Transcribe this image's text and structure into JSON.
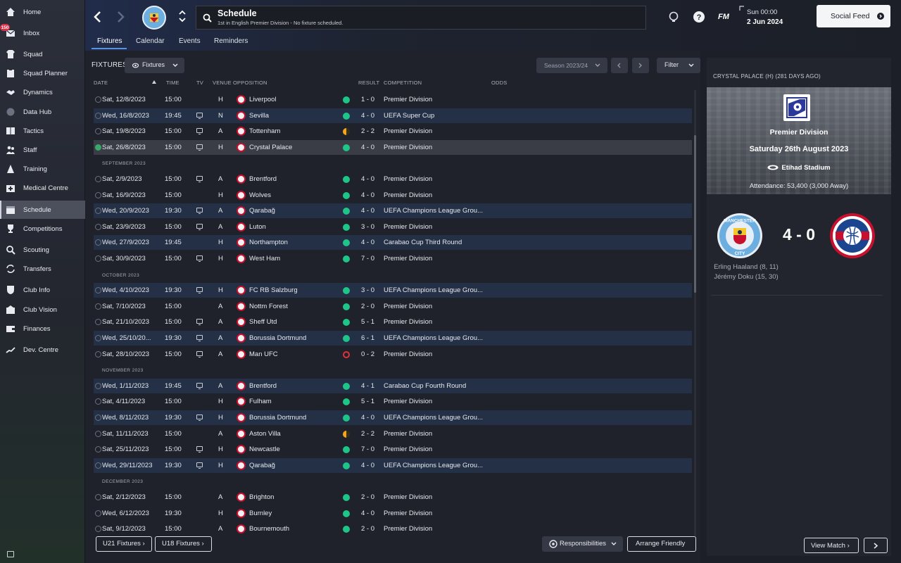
{
  "sidebar": {
    "items": [
      {
        "label": "Home",
        "icon": "home-icon"
      },
      {
        "label": "Inbox",
        "icon": "inbox-icon",
        "badge": "150"
      },
      {
        "label": "Squad",
        "icon": "shirt-icon"
      },
      {
        "label": "Squad Planner",
        "icon": "clipboard-icon"
      },
      {
        "label": "Dynamics",
        "icon": "handshake-icon"
      },
      {
        "label": "Data Hub",
        "icon": "data-hub-icon"
      },
      {
        "label": "Tactics",
        "icon": "tactics-board-icon"
      },
      {
        "label": "Staff",
        "icon": "staff-icon"
      },
      {
        "label": "Training",
        "icon": "cone-icon"
      },
      {
        "label": "Medical Centre",
        "icon": "medical-kit-icon"
      },
      {
        "label": "Schedule",
        "icon": "calendar-icon",
        "active": true
      },
      {
        "label": "Competitions",
        "icon": "trophy-icon"
      },
      {
        "label": "Scouting",
        "icon": "magnifier-icon"
      },
      {
        "label": "Transfers",
        "icon": "transfer-arrows-icon"
      },
      {
        "label": "Club Info",
        "icon": "club-shield-icon"
      },
      {
        "label": "Club Vision",
        "icon": "vision-icon"
      },
      {
        "label": "Finances",
        "icon": "wallet-icon"
      },
      {
        "label": "Dev. Centre",
        "icon": "growth-line-icon"
      }
    ]
  },
  "header": {
    "title": "Schedule",
    "subtitle": "1st in English Premier Division - No fixture scheduled.",
    "tabs": [
      "Fixtures",
      "Calendar",
      "Events",
      "Reminders"
    ],
    "fm_label": "FM",
    "time": "Sun 00:00",
    "date": "2 Jun 2024",
    "social_feed": "Social Feed"
  },
  "toolbar": {
    "fixtures_label": "FIXTURES",
    "view_dropdown": "Fixtures",
    "season": "Season 2023/24",
    "filter": "Filter"
  },
  "columns": {
    "date": "DATE",
    "time": "TIME",
    "tv": "TV",
    "venue": "VENUE",
    "opposition": "OPPOSITION",
    "result": "RESULT",
    "competition": "COMPETITION",
    "odds": "ODDS"
  },
  "fixtures": [
    {
      "date": "Sat, 12/8/2023",
      "time": "15:00",
      "tv": false,
      "venue": "H",
      "opp": "Liverpool",
      "result": "1 - 0",
      "comp": "Premier Division",
      "outcome": "win",
      "euro": false
    },
    {
      "date": "Wed, 16/8/2023",
      "time": "19:45",
      "tv": true,
      "venue": "N",
      "opp": "Sevilla",
      "result": "4 - 0",
      "comp": "UEFA Super Cup",
      "outcome": "win",
      "euro": true
    },
    {
      "date": "Sat, 19/8/2023",
      "time": "15:00",
      "tv": true,
      "venue": "A",
      "opp": "Tottenham",
      "result": "2 - 2",
      "comp": "Premier Division",
      "outcome": "draw",
      "euro": false
    },
    {
      "date": "Sat, 26/8/2023",
      "time": "15:00",
      "tv": true,
      "venue": "H",
      "opp": "Crystal Palace",
      "result": "4 - 0",
      "comp": "Premier Division",
      "outcome": "win",
      "euro": false,
      "selected": true
    },
    {
      "month": "SEPTEMBER 2023"
    },
    {
      "date": "Sat, 2/9/2023",
      "time": "15:00",
      "tv": true,
      "venue": "A",
      "opp": "Brentford",
      "result": "4 - 0",
      "comp": "Premier Division",
      "outcome": "win",
      "euro": false
    },
    {
      "date": "Sat, 16/9/2023",
      "time": "15:00",
      "tv": false,
      "venue": "H",
      "opp": "Wolves",
      "result": "4 - 0",
      "comp": "Premier Division",
      "outcome": "win",
      "euro": false
    },
    {
      "date": "Wed, 20/9/2023",
      "time": "19:30",
      "tv": true,
      "venue": "A",
      "opp": "Qarabağ",
      "result": "4 - 0",
      "comp": "UEFA Champions League Grou...",
      "outcome": "win",
      "euro": true
    },
    {
      "date": "Sat, 23/9/2023",
      "time": "15:00",
      "tv": true,
      "venue": "A",
      "opp": "Luton",
      "result": "3 - 0",
      "comp": "Premier Division",
      "outcome": "win",
      "euro": false
    },
    {
      "date": "Wed, 27/9/2023",
      "time": "19:45",
      "tv": false,
      "venue": "H",
      "opp": "Northampton",
      "result": "4 - 0",
      "comp": "Carabao Cup Third Round",
      "outcome": "win",
      "euro": true
    },
    {
      "date": "Sat, 30/9/2023",
      "time": "15:00",
      "tv": true,
      "venue": "H",
      "opp": "West Ham",
      "result": "7 - 0",
      "comp": "Premier Division",
      "outcome": "win",
      "euro": false
    },
    {
      "month": "OCTOBER 2023"
    },
    {
      "date": "Wed, 4/10/2023",
      "time": "19:30",
      "tv": true,
      "venue": "H",
      "opp": "FC RB Salzburg",
      "result": "3 - 0",
      "comp": "UEFA Champions League Grou...",
      "outcome": "win",
      "euro": true
    },
    {
      "date": "Sat, 7/10/2023",
      "time": "15:00",
      "tv": false,
      "venue": "A",
      "opp": "Nottm Forest",
      "result": "2 - 0",
      "comp": "Premier Division",
      "outcome": "win",
      "euro": false
    },
    {
      "date": "Sat, 21/10/2023",
      "time": "15:00",
      "tv": true,
      "venue": "A",
      "opp": "Sheff Utd",
      "result": "5 - 1",
      "comp": "Premier Division",
      "outcome": "win",
      "euro": false
    },
    {
      "date": "Wed, 25/10/20...",
      "time": "19:30",
      "tv": true,
      "venue": "A",
      "opp": "Borussia Dortmund",
      "result": "6 - 1",
      "comp": "UEFA Champions League Grou...",
      "outcome": "win",
      "euro": true
    },
    {
      "date": "Sat, 28/10/2023",
      "time": "15:00",
      "tv": true,
      "venue": "A",
      "opp": "Man UFC",
      "result": "0 - 2",
      "comp": "Premier Division",
      "outcome": "loss",
      "euro": false
    },
    {
      "month": "NOVEMBER 2023"
    },
    {
      "date": "Wed, 1/11/2023",
      "time": "19:45",
      "tv": true,
      "venue": "A",
      "opp": "Brentford",
      "result": "4 - 1",
      "comp": "Carabao Cup Fourth Round",
      "outcome": "win",
      "euro": true
    },
    {
      "date": "Sat, 4/11/2023",
      "time": "15:00",
      "tv": false,
      "venue": "H",
      "opp": "Fulham",
      "result": "5 - 1",
      "comp": "Premier Division",
      "outcome": "win",
      "euro": false
    },
    {
      "date": "Wed, 8/11/2023",
      "time": "19:30",
      "tv": true,
      "venue": "H",
      "opp": "Borussia Dortmund",
      "result": "4 - 0",
      "comp": "UEFA Champions League Grou...",
      "outcome": "win",
      "euro": true
    },
    {
      "date": "Sat, 11/11/2023",
      "time": "15:00",
      "tv": false,
      "venue": "A",
      "opp": "Aston Villa",
      "result": "2 - 2",
      "comp": "Premier Division",
      "outcome": "draw",
      "euro": false
    },
    {
      "date": "Sat, 25/11/2023",
      "time": "15:00",
      "tv": true,
      "venue": "H",
      "opp": "Newcastle",
      "result": "7 - 0",
      "comp": "Premier Division",
      "outcome": "win",
      "euro": false
    },
    {
      "date": "Wed, 29/11/2023",
      "time": "19:30",
      "tv": true,
      "venue": "H",
      "opp": "Qarabağ",
      "result": "4 - 0",
      "comp": "UEFA Champions League Grou...",
      "outcome": "win",
      "euro": true
    },
    {
      "month": "DECEMBER 2023"
    },
    {
      "date": "Sat, 2/12/2023",
      "time": "15:00",
      "tv": false,
      "venue": "A",
      "opp": "Brighton",
      "result": "2 - 0",
      "comp": "Premier Division",
      "outcome": "win",
      "euro": false
    },
    {
      "date": "Wed, 6/12/2023",
      "time": "19:30",
      "tv": false,
      "venue": "H",
      "opp": "Burnley",
      "result": "4 - 0",
      "comp": "Premier Division",
      "outcome": "win",
      "euro": false
    },
    {
      "date": "Sat, 9/12/2023",
      "time": "15:00",
      "tv": false,
      "venue": "A",
      "opp": "Bournemouth",
      "result": "2 - 0",
      "comp": "Premier Division",
      "outcome": "win",
      "euro": false
    }
  ],
  "colors": {
    "win": "#1fc487",
    "draw": "#f2a51f",
    "loss": "#e0313b",
    "accent": "#5a91e0"
  },
  "footer": {
    "u21": "U21 Fixtures",
    "u18": "U18 Fixtures",
    "responsibilities": "Responsibilities",
    "arrange_friendly": "Arrange Friendly"
  },
  "match_panel": {
    "title": "CRYSTAL PALACE (H) (281 DAYS AGO)",
    "competition": "Premier Division",
    "date": "Saturday 26th August 2023",
    "stadium": "Etihad Stadium",
    "attendance": "Attendance: 53,400 (3,000 Away)",
    "home_crest_text": "MANCHESTER",
    "home_crest_sub": "CITY",
    "score": "4 - 0",
    "scorers": [
      "Erling Haaland (8, 11)",
      "Jérémy Doku (15, 30)"
    ],
    "view_match": "View Match"
  }
}
